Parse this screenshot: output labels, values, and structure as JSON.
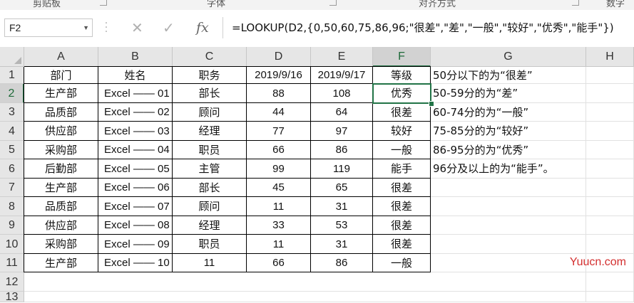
{
  "ribbon": {
    "groups": [
      "剪贴板",
      "字体",
      "对齐方式",
      "数字"
    ]
  },
  "formula_bar": {
    "name_box": "F2",
    "cancel_icon": "✕",
    "confirm_icon": "✓",
    "fx_label": "fx",
    "formula": "=LOOKUP(D2,{0,50,60,75,86,96;\"很差\",\"差\",\"一般\",\"较好\",\"优秀\",\"能手\"})"
  },
  "columns": [
    "A",
    "B",
    "C",
    "D",
    "E",
    "F",
    "G",
    "H"
  ],
  "selected_cell": "F2",
  "rows": [
    [
      "部门",
      "姓名",
      "职务",
      "2019/9/16",
      "2019/9/17",
      "等级",
      "50分以下的为“很差”"
    ],
    [
      "生产部",
      "Excel —— 01",
      "部长",
      "88",
      "108",
      "优秀",
      "50-59分的为“差”"
    ],
    [
      "品质部",
      "Excel —— 02",
      "顾问",
      "44",
      "64",
      "很差",
      "60-74分的为“一般”"
    ],
    [
      "供应部",
      "Excel —— 03",
      "经理",
      "77",
      "97",
      "较好",
      "75-85分的为“较好”"
    ],
    [
      "采购部",
      "Excel —— 04",
      "职员",
      "66",
      "86",
      "一般",
      "86-95分的为“优秀”"
    ],
    [
      "后勤部",
      "Excel —— 05",
      "主管",
      "99",
      "119",
      "能手",
      "96分及以上的为“能手”。"
    ],
    [
      "生产部",
      "Excel —— 06",
      "部长",
      "45",
      "65",
      "很差",
      ""
    ],
    [
      "品质部",
      "Excel —— 07",
      "顾问",
      "11",
      "31",
      "很差",
      ""
    ],
    [
      "供应部",
      "Excel —— 08",
      "经理",
      "33",
      "53",
      "很差",
      ""
    ],
    [
      "采购部",
      "Excel —— 09",
      "职员",
      "11",
      "31",
      "很差",
      ""
    ],
    [
      "生产部",
      "Excel —— 10",
      "11",
      "66",
      "86",
      "一般",
      ""
    ]
  ],
  "row_numbers": [
    "1",
    "2",
    "3",
    "4",
    "5",
    "6",
    "7",
    "8",
    "9",
    "10",
    "11",
    "12",
    "13"
  ],
  "watermark": "Yuucn.com"
}
